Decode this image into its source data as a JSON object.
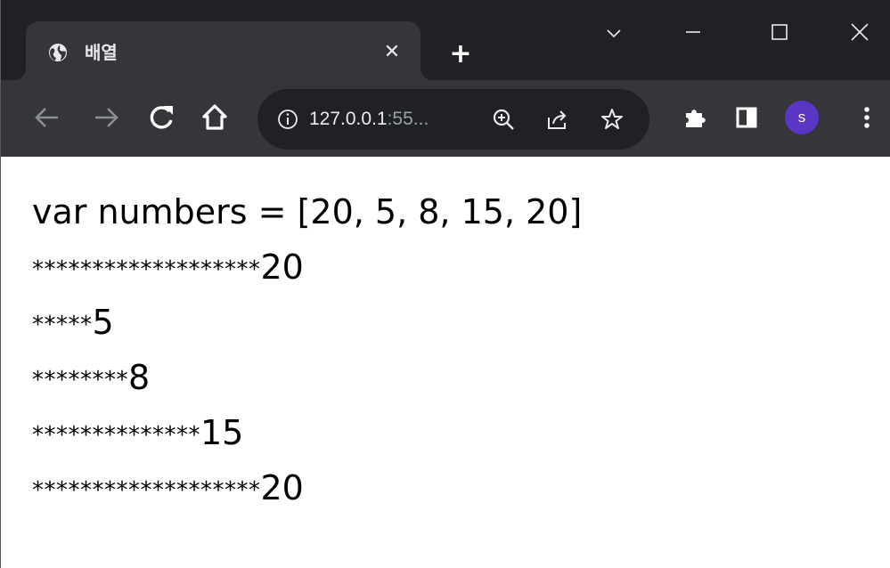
{
  "browser": {
    "tab": {
      "title": "배열",
      "favicon": "globe-icon"
    },
    "address_bar": {
      "url_host": "127.0.0.1",
      "url_rest": ":55..."
    },
    "profile_initial": "s",
    "colors": {
      "frame": "#202124",
      "toolbar": "#35363a",
      "profile_avatar": "#5b36c5"
    }
  },
  "page": {
    "code_line": "var numbers = [20, 5, 8, 15, 20]",
    "rows": [
      {
        "stars": "*******************",
        "value": "20"
      },
      {
        "stars": "*****",
        "value": "5"
      },
      {
        "stars": "********",
        "value": "8"
      },
      {
        "stars": "**************",
        "value": "15"
      },
      {
        "stars": "*******************",
        "value": "20"
      }
    ]
  }
}
